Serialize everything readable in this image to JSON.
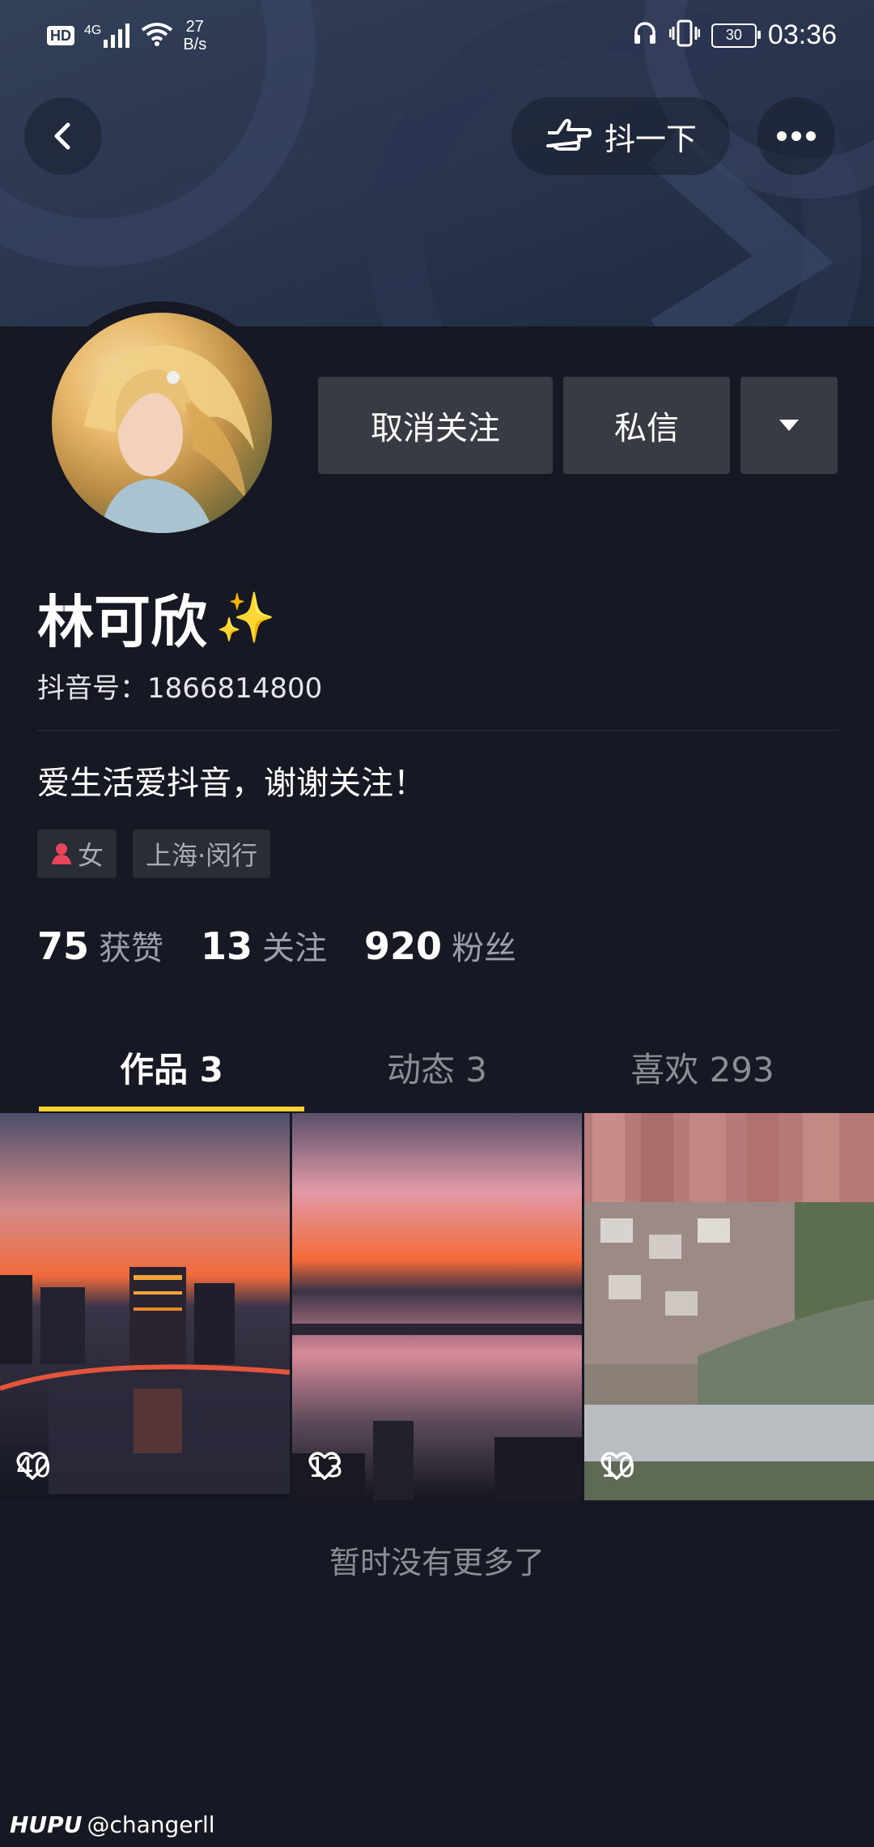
{
  "status_bar": {
    "hd": "HD",
    "network": "4G",
    "speed_value": "27",
    "speed_unit": "B/s",
    "battery": "30",
    "time": "03:36"
  },
  "header": {
    "shake_label": "抖一下"
  },
  "profile": {
    "unfollow_label": "取消关注",
    "message_label": "私信",
    "nickname": "林可欣",
    "nickname_emoji": "✨",
    "douyin_id": "抖音号：1866814800",
    "bio": "爱生活爱抖音，谢谢关注！",
    "tags": {
      "gender": "女",
      "location": "上海·闵行"
    },
    "stats": [
      {
        "num": "75",
        "label": "获赞"
      },
      {
        "num": "13",
        "label": "关注"
      },
      {
        "num": "920",
        "label": "粉丝"
      }
    ]
  },
  "tabs": [
    {
      "label": "作品 3"
    },
    {
      "label": "动态 3"
    },
    {
      "label": "喜欢 293"
    }
  ],
  "videos": [
    {
      "likes": "40"
    },
    {
      "likes": "13"
    },
    {
      "likes": "10"
    }
  ],
  "footer_note": "暂时没有更多了",
  "watermark": {
    "brand": "HUPU",
    "user": "@changerll"
  },
  "colors": {
    "background": "#161823",
    "tab_indicator": "#fbd230",
    "button_bg": "#393b44",
    "gender_icon": "#e8455a"
  }
}
